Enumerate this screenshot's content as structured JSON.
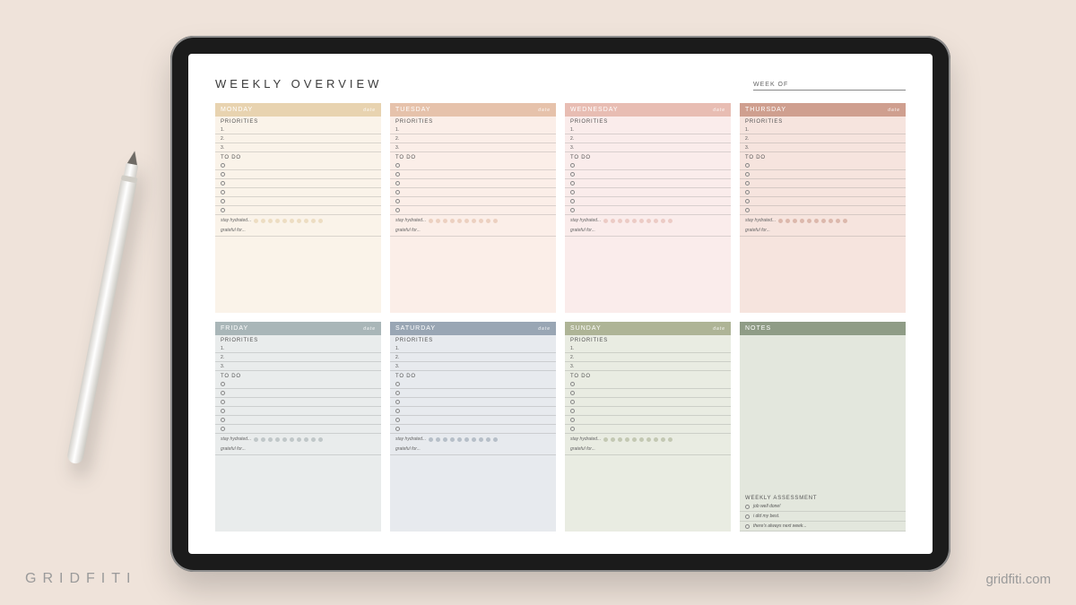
{
  "brand": {
    "logo_text": "GRIDFITI",
    "site": "gridfiti.com"
  },
  "planner": {
    "title": "WEEKLY OVERVIEW",
    "week_of_label": "WEEK OF",
    "labels": {
      "priorities": "PRIORITIES",
      "todo": "TO DO",
      "date": "date",
      "hydrated": "stay hydrated...",
      "grateful": "grateful for...",
      "notes": "NOTES",
      "assessment": "WEEKLY ASSESSMENT"
    },
    "priorities_numbers": [
      "1.",
      "2.",
      "3."
    ],
    "days": [
      {
        "name": "MONDAY",
        "theme": "mon"
      },
      {
        "name": "TUESDAY",
        "theme": "tue"
      },
      {
        "name": "WEDNESDAY",
        "theme": "wed"
      },
      {
        "name": "THURSDAY",
        "theme": "thu"
      },
      {
        "name": "FRIDAY",
        "theme": "fri"
      },
      {
        "name": "SATURDAY",
        "theme": "sat"
      },
      {
        "name": "SUNDAY",
        "theme": "sun"
      }
    ],
    "assessment_options": [
      "job well done!",
      "i did my best.",
      "there's always next week..."
    ]
  }
}
